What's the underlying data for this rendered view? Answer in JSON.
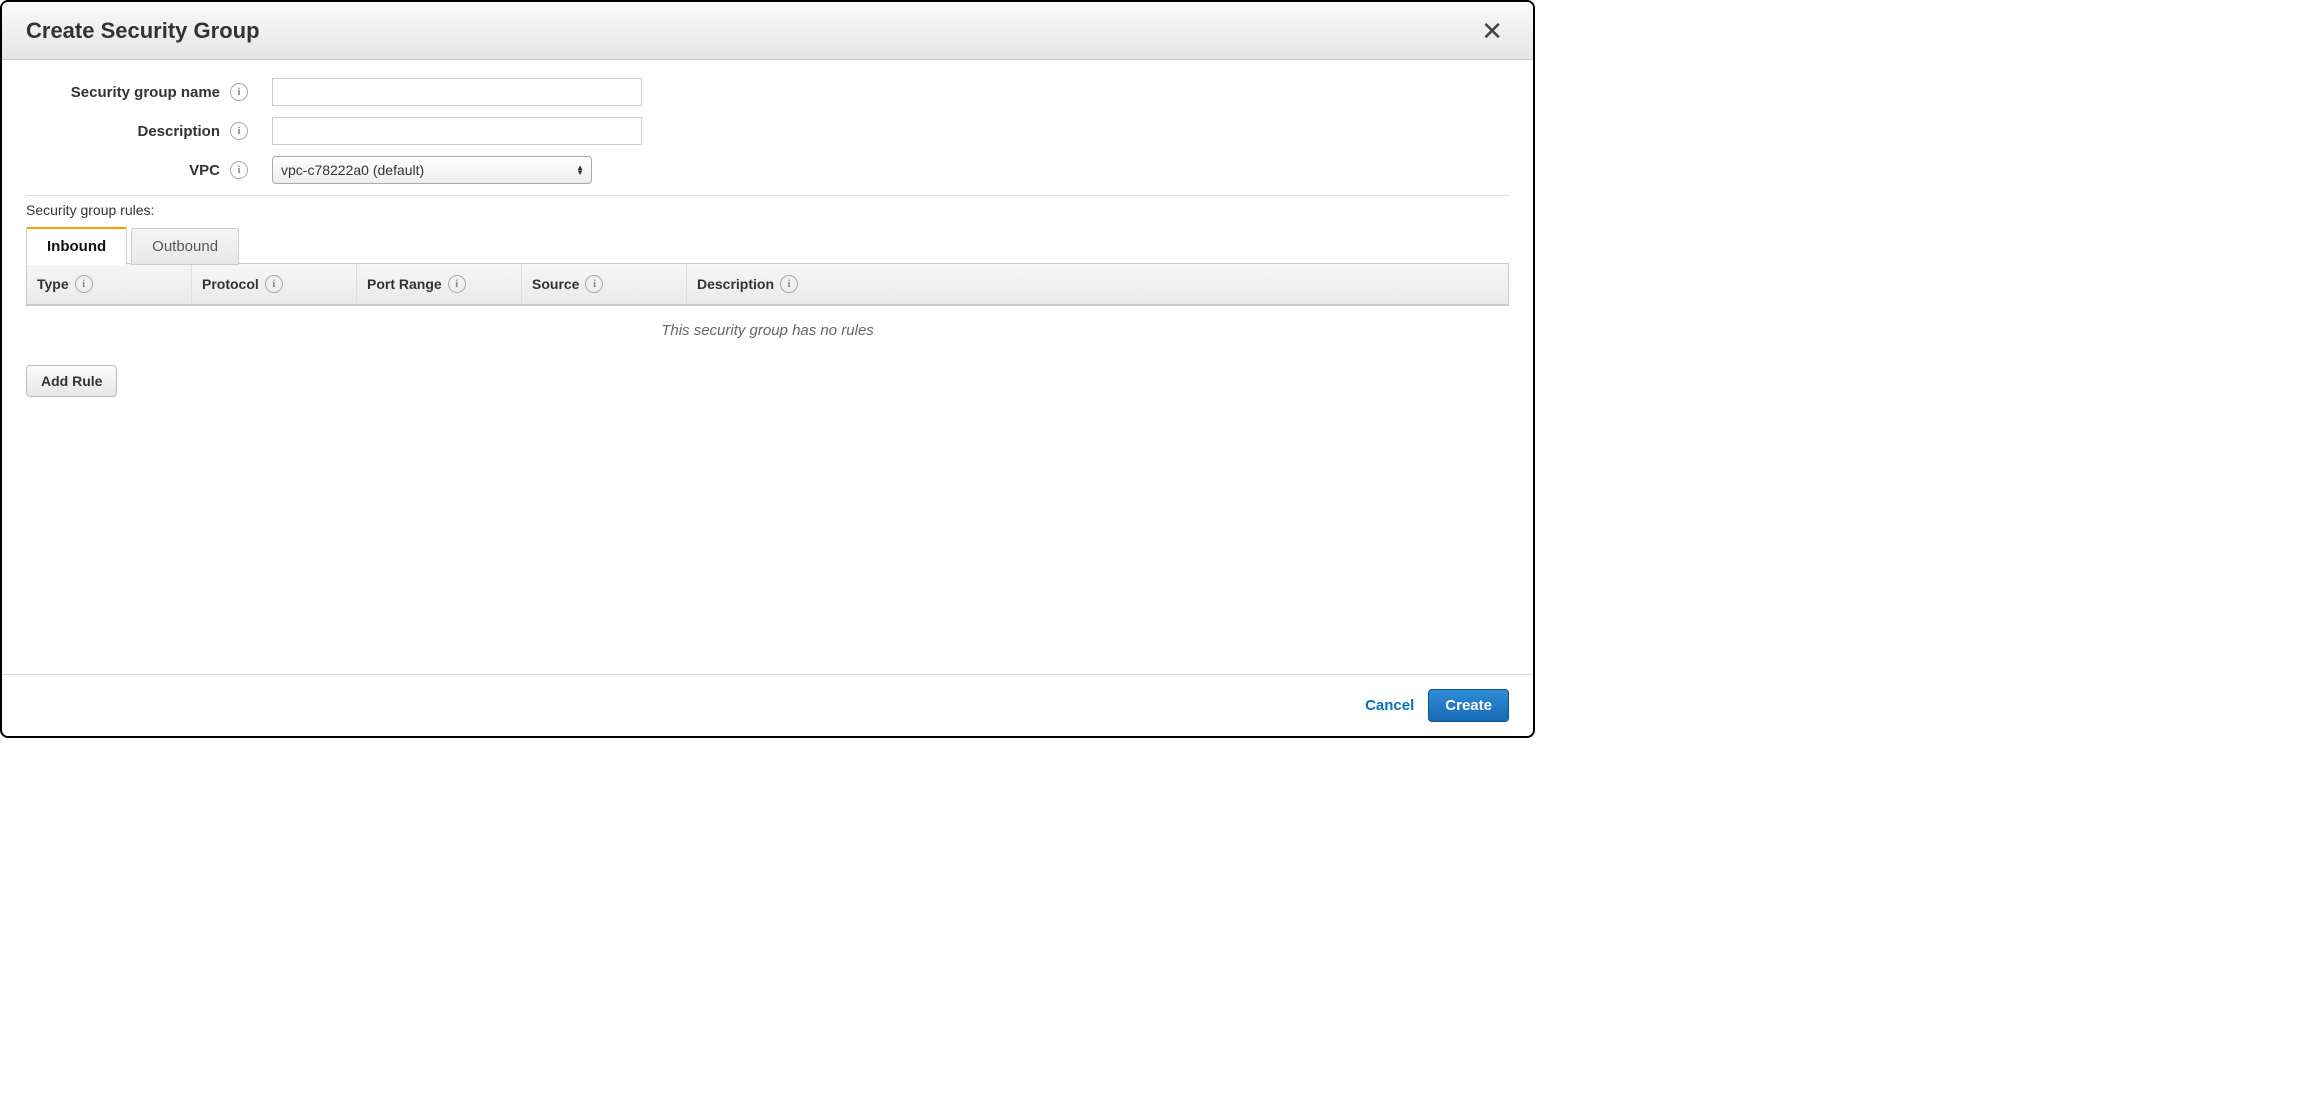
{
  "dialog": {
    "title": "Create Security Group"
  },
  "form": {
    "name_label": "Security group name",
    "name_value": "",
    "description_label": "Description",
    "description_value": "",
    "vpc_label": "VPC",
    "vpc_selected": "vpc-c78222a0 (default)"
  },
  "rules": {
    "section_label": "Security group rules:",
    "tabs": {
      "inbound": "Inbound",
      "outbound": "Outbound"
    },
    "columns": {
      "type": "Type",
      "protocol": "Protocol",
      "port_range": "Port Range",
      "source": "Source",
      "description": "Description"
    },
    "empty_message": "This security group has no rules",
    "add_rule_label": "Add Rule"
  },
  "footer": {
    "cancel": "Cancel",
    "create": "Create"
  }
}
